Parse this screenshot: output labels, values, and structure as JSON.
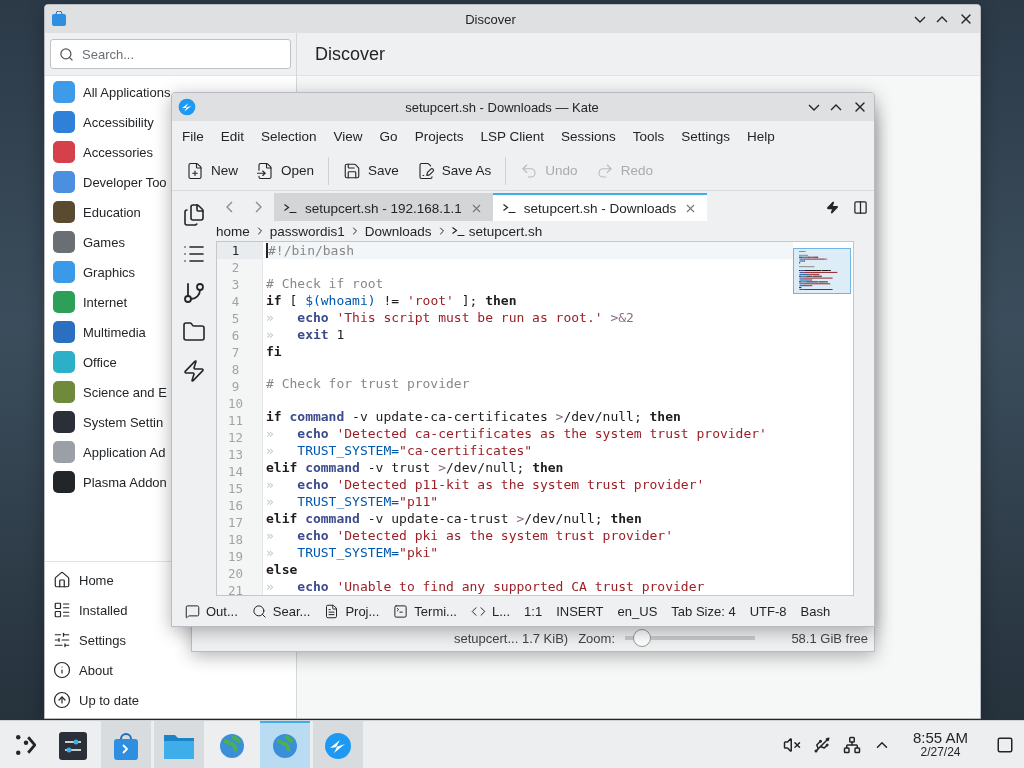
{
  "discover": {
    "title": "Discover",
    "search": {
      "placeholder": "Search..."
    },
    "heading": "Discover",
    "categories": [
      {
        "label": "All Applications",
        "color": "#3d9be9"
      },
      {
        "label": "Accessibility",
        "color": "#2f80d8"
      },
      {
        "label": "Accessories",
        "color": "#d6404b"
      },
      {
        "label": "Developer Too",
        "color": "#4a8fe0"
      },
      {
        "label": "Education",
        "color": "#5a4a30"
      },
      {
        "label": "Games",
        "color": "#6a6f75"
      },
      {
        "label": "Graphics",
        "color": "#3a9ae8"
      },
      {
        "label": "Internet",
        "color": "#2e9f58"
      },
      {
        "label": "Multimedia",
        "color": "#2a6fc0"
      },
      {
        "label": "Office",
        "color": "#2bb0c8"
      },
      {
        "label": "Science and E",
        "color": "#6f8a3a"
      },
      {
        "label": "System Settin",
        "color": "#2b3038"
      },
      {
        "label": "Application Ad",
        "color": "#9aa0a6"
      },
      {
        "label": "Plasma Addon",
        "color": "#232629"
      }
    ],
    "nav": [
      {
        "label": "Home",
        "kind": "home"
      },
      {
        "label": "Installed",
        "kind": "installed"
      },
      {
        "label": "Settings",
        "kind": "settings"
      },
      {
        "label": "About",
        "kind": "about"
      },
      {
        "label": "Up to date",
        "kind": "update"
      }
    ]
  },
  "dialog": {
    "file_info": "setupcert... 1.7 KiB)",
    "zoom": {
      "label": "Zoom:",
      "level": 0.06
    },
    "free_space": "58.1 GiB free"
  },
  "kate": {
    "title": "setupcert.sh - Downloads — Kate",
    "menu": [
      "File",
      "Edit",
      "Selection",
      "View",
      "Go",
      "Projects",
      "LSP Client",
      "Sessions",
      "Tools",
      "Settings",
      "Help"
    ],
    "toolbar": [
      [
        {
          "label": "New",
          "kind": "new",
          "disabled": false
        },
        {
          "label": "Open",
          "kind": "open",
          "disabled": false
        }
      ],
      [
        {
          "label": "Save",
          "kind": "save",
          "disabled": false
        },
        {
          "label": "Save As",
          "kind": "saveas",
          "disabled": false
        }
      ],
      [
        {
          "label": "Undo",
          "kind": "undo",
          "disabled": true
        },
        {
          "label": "Redo",
          "kind": "redo",
          "disabled": true
        }
      ]
    ],
    "tabs": [
      {
        "label": "setupcert.sh - 192.168.1.1",
        "selected": false
      },
      {
        "label": "setupcert.sh - Downloads",
        "selected": true
      }
    ],
    "breadcrumb": [
      "home",
      "passwordis1",
      "Downloads",
      "setupcert.sh"
    ],
    "lines": [
      {
        "number": "1",
        "current": true,
        "tokens": [
          {
            "t": "#!/bin/bash",
            "kind": "comment"
          }
        ]
      },
      {
        "number": "2",
        "current": false
      },
      {
        "number": "3",
        "current": false,
        "tokens": [
          {
            "t": "# Check if root",
            "kind": "comment"
          }
        ]
      },
      {
        "number": "4",
        "current": false,
        "tokens": [
          {
            "t": "if",
            "kind": "keyword"
          },
          {
            "t": " [ ",
            "kind": "plain"
          },
          {
            "t": "$(whoami)",
            "kind": "variable"
          },
          {
            "t": " != ",
            "kind": "plain"
          },
          {
            "t": "'root'",
            "kind": "string"
          },
          {
            "t": " ]; ",
            "kind": "plain"
          },
          {
            "t": "then",
            "kind": "keyword"
          }
        ]
      },
      {
        "number": "5",
        "current": false,
        "tokens": [
          {
            "t": "»",
            "kind": "tabmark"
          },
          {
            "t": "   echo",
            "kind": "builtin"
          },
          {
            "t": " 'This script must be run as root.'",
            "kind": "string"
          },
          {
            "t": " >&2",
            "kind": "redirect"
          }
        ]
      },
      {
        "number": "6",
        "current": false,
        "tokens": [
          {
            "t": "»",
            "kind": "tabmark"
          },
          {
            "t": "   exit",
            "kind": "builtin"
          },
          {
            "t": " 1",
            "kind": "plain"
          }
        ]
      },
      {
        "number": "7",
        "current": false,
        "tokens": [
          {
            "t": "fi",
            "kind": "keyword"
          }
        ]
      },
      {
        "number": "8",
        "current": false
      },
      {
        "number": "9",
        "current": false,
        "tokens": [
          {
            "t": "# Check for trust provider",
            "kind": "comment"
          }
        ]
      },
      {
        "number": "10",
        "current": false
      },
      {
        "number": "11",
        "current": false,
        "tokens": [
          {
            "t": "if",
            "kind": "keyword"
          },
          {
            "t": " command",
            "kind": "builtin"
          },
          {
            "t": " -v update-ca-certificates ",
            "kind": "plain"
          },
          {
            "t": ">",
            "kind": "redirect"
          },
          {
            "t": "/dev/null; ",
            "kind": "plain"
          },
          {
            "t": "then",
            "kind": "keyword"
          }
        ]
      },
      {
        "number": "12",
        "current": false,
        "tokens": [
          {
            "t": "»",
            "kind": "tabmark"
          },
          {
            "t": "   echo",
            "kind": "builtin"
          },
          {
            "t": " 'Detected ca-certificates as the system trust provider'",
            "kind": "string"
          }
        ]
      },
      {
        "number": "13",
        "current": false,
        "tokens": [
          {
            "t": "»",
            "kind": "tabmark"
          },
          {
            "t": "   TRUST_SYSTEM=",
            "kind": "variable"
          },
          {
            "t": "\"ca-certificates\"",
            "kind": "string"
          }
        ]
      },
      {
        "number": "14",
        "current": false,
        "tokens": [
          {
            "t": "elif",
            "kind": "keyword"
          },
          {
            "t": " command",
            "kind": "builtin"
          },
          {
            "t": " -v trust ",
            "kind": "plain"
          },
          {
            "t": ">",
            "kind": "redirect"
          },
          {
            "t": "/dev/null; ",
            "kind": "plain"
          },
          {
            "t": "then",
            "kind": "keyword"
          }
        ]
      },
      {
        "number": "15",
        "current": false,
        "tokens": [
          {
            "t": "»",
            "kind": "tabmark"
          },
          {
            "t": "   echo",
            "kind": "builtin"
          },
          {
            "t": " 'Detected p11-kit as the system trust provider'",
            "kind": "string"
          }
        ]
      },
      {
        "number": "16",
        "current": false,
        "tokens": [
          {
            "t": "»",
            "kind": "tabmark"
          },
          {
            "t": "   TRUST_SYSTEM=",
            "kind": "variable"
          },
          {
            "t": "\"p11\"",
            "kind": "string"
          }
        ]
      },
      {
        "number": "17",
        "current": false,
        "tokens": [
          {
            "t": "elif",
            "kind": "keyword"
          },
          {
            "t": " command",
            "kind": "builtin"
          },
          {
            "t": " -v update-ca-trust ",
            "kind": "plain"
          },
          {
            "t": ">",
            "kind": "redirect"
          },
          {
            "t": "/dev/null; ",
            "kind": "plain"
          },
          {
            "t": "then",
            "kind": "keyword"
          }
        ]
      },
      {
        "number": "18",
        "current": false,
        "tokens": [
          {
            "t": "»",
            "kind": "tabmark"
          },
          {
            "t": "   echo",
            "kind": "builtin"
          },
          {
            "t": " 'Detected pki as the system trust provider'",
            "kind": "string"
          }
        ]
      },
      {
        "number": "19",
        "current": false,
        "tokens": [
          {
            "t": "»",
            "kind": "tabmark"
          },
          {
            "t": "   TRUST_SYSTEM=",
            "kind": "variable"
          },
          {
            "t": "\"pki\"",
            "kind": "string"
          }
        ]
      },
      {
        "number": "20",
        "current": false,
        "tokens": [
          {
            "t": "else",
            "kind": "keyword"
          }
        ]
      },
      {
        "number": "21",
        "current": false,
        "tokens": [
          {
            "t": "»",
            "kind": "tabmark"
          },
          {
            "t": "   echo",
            "kind": "builtin"
          },
          {
            "t": " 'Unable to find any supported CA trust provider",
            "kind": "string"
          }
        ]
      }
    ],
    "tool_views": [
      {
        "label": "Out...",
        "kind": "output"
      },
      {
        "label": "Sear...",
        "kind": "search"
      },
      {
        "label": "Proj...",
        "kind": "project"
      },
      {
        "label": "Termi...",
        "kind": "terminal"
      },
      {
        "label": "L...",
        "kind": "code"
      }
    ],
    "status": [
      "1:1",
      "INSERT",
      "en_US",
      "Tab Size: 4",
      "UTF-8",
      "Bash"
    ]
  },
  "taskbar": {
    "tasks": [
      {
        "kind": "settings",
        "open": false,
        "selected": false
      },
      {
        "kind": "discover",
        "open": true,
        "selected": false
      },
      {
        "kind": "files",
        "open": true,
        "selected": false
      },
      {
        "kind": "globe",
        "open": false,
        "selected": false
      },
      {
        "kind": "globe",
        "open": true,
        "selected": true
      },
      {
        "kind": "kate",
        "open": true,
        "selected": false
      }
    ],
    "clock": {
      "time": "8:55 AM",
      "date": "2/27/24"
    }
  }
}
